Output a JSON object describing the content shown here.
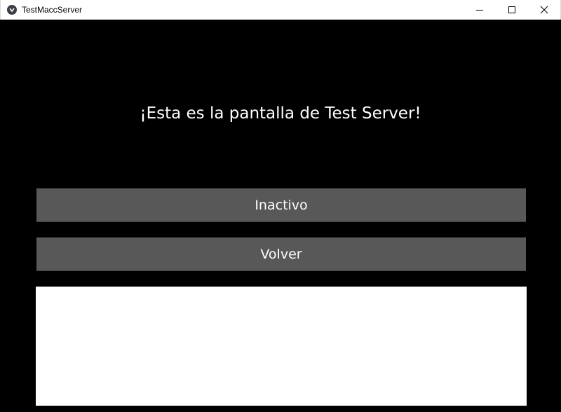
{
  "window": {
    "title": "TestMaccServer"
  },
  "main": {
    "heading": "¡Esta es la pantalla de Test Server!",
    "buttons": {
      "inactivo_label": "Inactivo",
      "volver_label": "Volver"
    },
    "log_text": ""
  },
  "colors": {
    "background": "#000000",
    "button_bg": "#585858",
    "text": "#ffffff",
    "log_bg": "#ffffff"
  },
  "icons": {
    "app": "kivy-app-icon",
    "minimize": "minimize-icon",
    "maximize": "maximize-icon",
    "close": "close-icon"
  }
}
